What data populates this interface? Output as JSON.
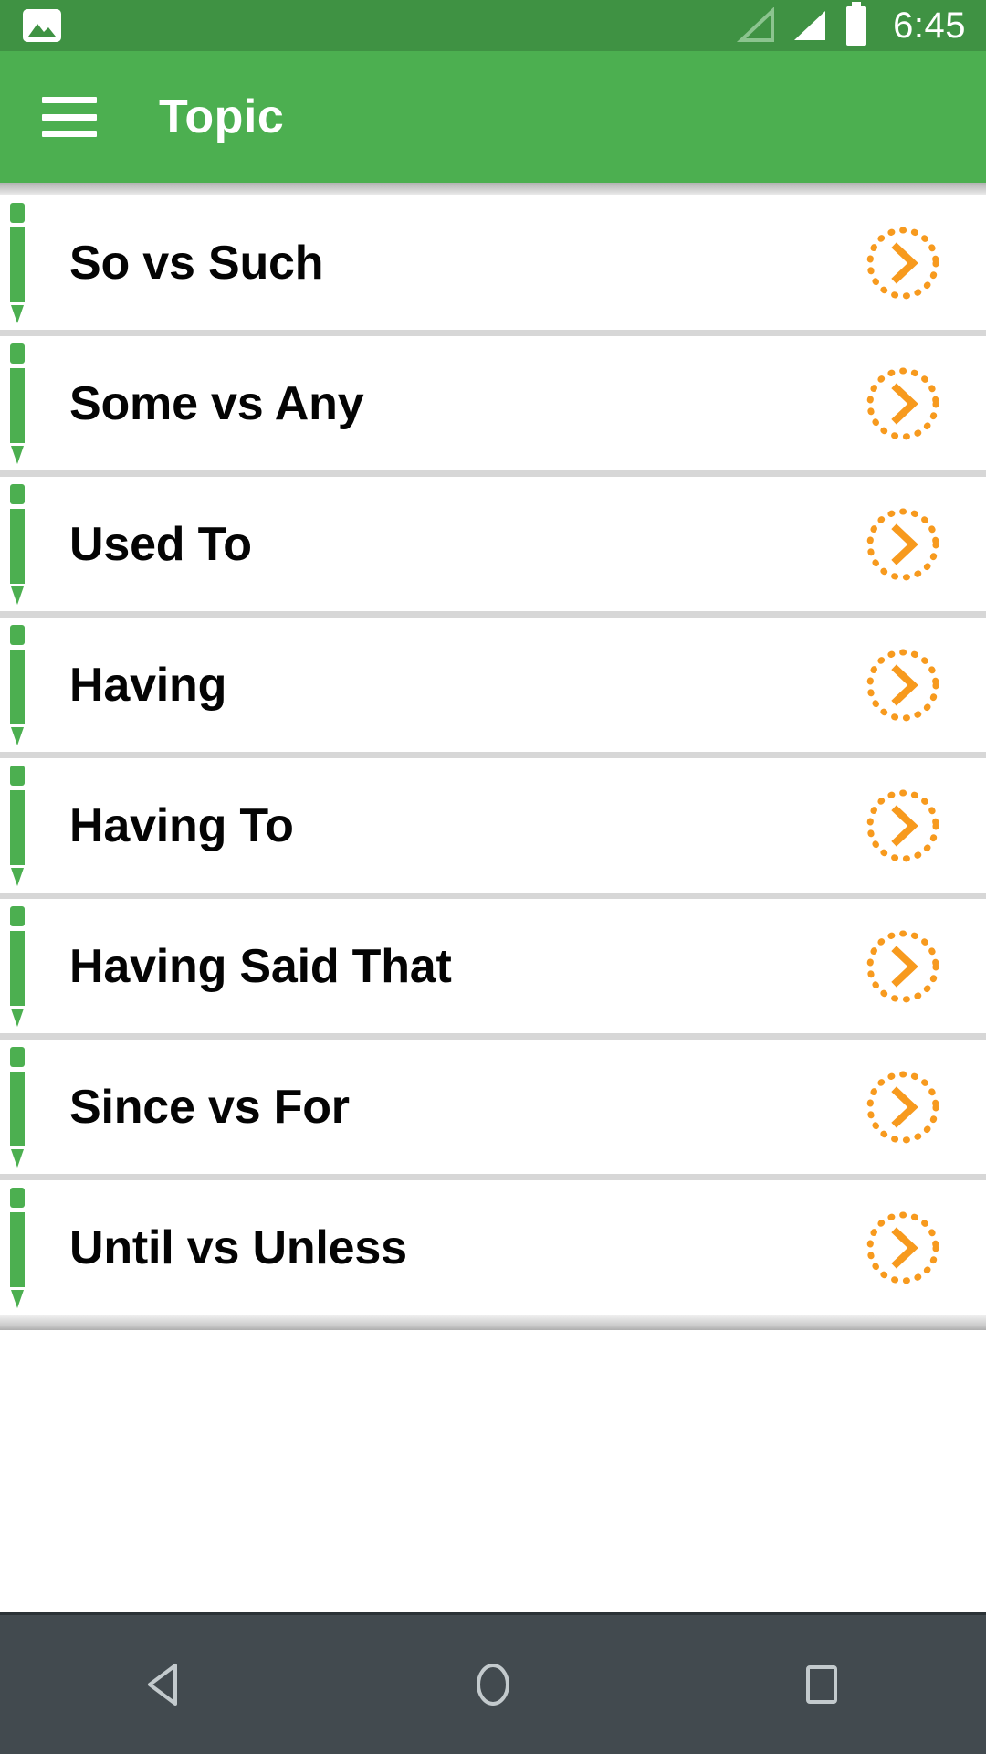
{
  "status_bar": {
    "photo_icon": "photo-icon",
    "signal_icon_1": "signal-empty-icon",
    "signal_icon_2": "signal-full-icon",
    "battery_icon": "battery-icon",
    "time": "6:45"
  },
  "app_bar": {
    "menu_icon": "hamburger-menu-icon",
    "title": "Topic"
  },
  "colors": {
    "status_bar_green": "#3f9243",
    "app_bar_green": "#4caf50",
    "pencil_green": "#4caf50",
    "arrow_orange": "#f79a1e",
    "nav_bar_dark": "#424a4f",
    "list_bg": "#d7d7d7",
    "item_bg": "#ffffff",
    "item_text": "#040404"
  },
  "list": {
    "items": [
      {
        "label": "So vs Such",
        "leading_icon": "pencil-icon",
        "action_icon": "chevron-right-dotted-circle-icon"
      },
      {
        "label": "Some vs Any",
        "leading_icon": "pencil-icon",
        "action_icon": "chevron-right-dotted-circle-icon"
      },
      {
        "label": "Used To",
        "leading_icon": "pencil-icon",
        "action_icon": "chevron-right-dotted-circle-icon"
      },
      {
        "label": "Having",
        "leading_icon": "pencil-icon",
        "action_icon": "chevron-right-dotted-circle-icon"
      },
      {
        "label": "Having To",
        "leading_icon": "pencil-icon",
        "action_icon": "chevron-right-dotted-circle-icon"
      },
      {
        "label": "Having Said That",
        "leading_icon": "pencil-icon",
        "action_icon": "chevron-right-dotted-circle-icon"
      },
      {
        "label": "Since vs For",
        "leading_icon": "pencil-icon",
        "action_icon": "chevron-right-dotted-circle-icon"
      },
      {
        "label": "Until vs Unless",
        "leading_icon": "pencil-icon",
        "action_icon": "chevron-right-dotted-circle-icon"
      }
    ]
  },
  "nav_bar": {
    "back": "back-triangle-icon",
    "home": "home-circle-icon",
    "recents": "recents-square-icon"
  }
}
